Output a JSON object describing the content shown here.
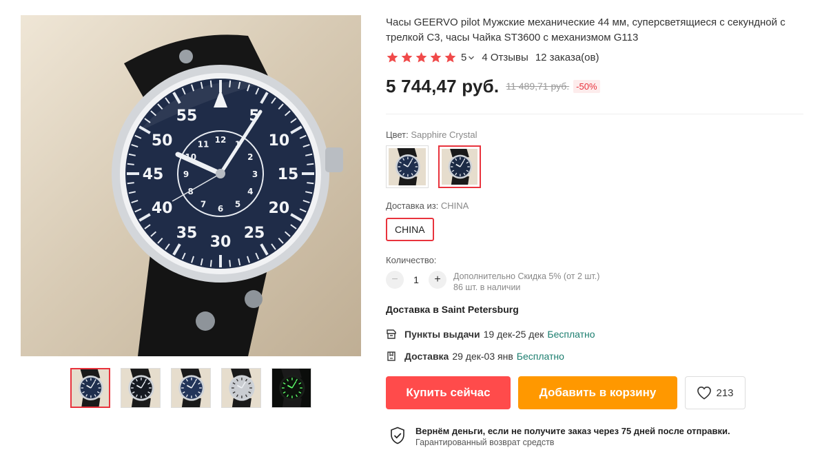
{
  "product": {
    "title": "Часы GEERVO pilot Мужские механические 44 мм, суперсветящиеся с секундной с трелкой C3, часы Чайка ST3600 с механизмом G113",
    "rating": "5",
    "reviews": "4 Отзывы",
    "orders": "12 заказа(ов)",
    "price": "5 744,47 руб.",
    "old_price": "11 489,71 руб.",
    "discount": "-50%"
  },
  "gallery": {
    "thumbnails": [
      "blue-dial-watch",
      "black-dial-watch",
      "blue-dial-watch-front",
      "silver-case-watch",
      "luminous-dial-watch"
    ],
    "active_index": 0,
    "dial_numbers": [
      "55",
      "5",
      "10",
      "15",
      "20",
      "25",
      "30",
      "35",
      "40",
      "45",
      "50"
    ],
    "inner_numbers": [
      "12",
      "1",
      "2",
      "3",
      "4",
      "5",
      "6",
      "7",
      "8",
      "9",
      "10",
      "11"
    ]
  },
  "options": {
    "color_label": "Цвет:",
    "color_value": "Sapphire Crystal",
    "ship_from_label": "Доставка из:",
    "ship_from_value": "CHINA",
    "ship_from_option": "CHINA",
    "qty_label": "Количество:",
    "qty_value": "1",
    "qty_minus": "−",
    "qty_plus": "+",
    "qty_discount": "Дополнительно Скидка 5% (от 2 шт.)",
    "qty_stock": "86 шт. в наличии"
  },
  "delivery": {
    "title": "Доставка в Saint Petersburg",
    "pickup_label": "Пункты выдачи",
    "pickup_dates": "19 дек-25 дек",
    "pickup_price": "Бесплатно",
    "courier_label": "Доставка",
    "courier_dates": "29 дек-03 янв",
    "courier_price": "Бесплатно"
  },
  "actions": {
    "buy_now": "Купить сейчас",
    "add_to_cart": "Добавить в корзину",
    "wishlist_count": "213"
  },
  "guarantee": {
    "main": "Вернём деньги, если не получите заказ через 75 дней после отправки.",
    "sub": "Гарантированный возврат средств"
  },
  "colors": {
    "accent": "#e8323c",
    "buy_now": "#ff4b4b",
    "add_to_cart": "#ff9800",
    "free": "#1a7d6e",
    "star": "#f04a4a"
  },
  "icons": [
    "star-icon",
    "chevron-down-icon",
    "pickup-point-icon",
    "delivery-box-icon",
    "heart-icon",
    "shield-check-icon"
  ]
}
